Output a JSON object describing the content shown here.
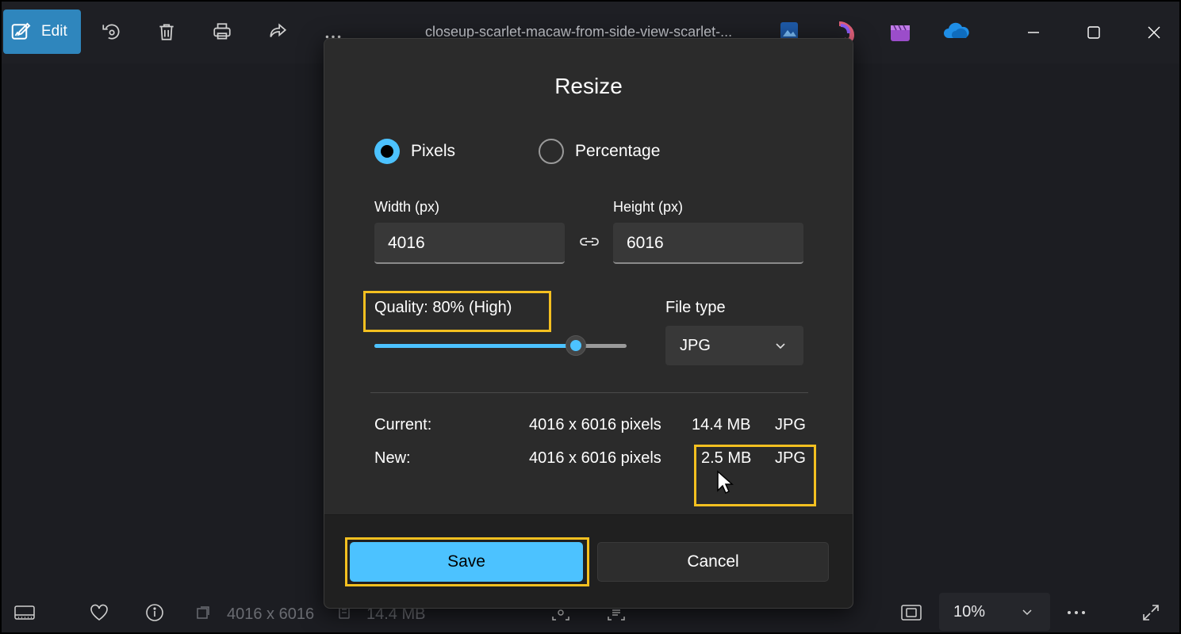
{
  "toolbar": {
    "edit_label": "Edit",
    "icons": [
      "edit-icon",
      "rotate-icon",
      "delete-icon",
      "print-icon",
      "share-icon",
      "more-icon"
    ],
    "file_title": "closeup-scarlet-macaw-from-side-view-scarlet-...",
    "app_icons": [
      "photo-editor-app-icon",
      "clipchamp-app-icon",
      "video-editor-app-icon",
      "onedrive-icon"
    ],
    "window_controls": [
      "minimize-icon",
      "maximize-icon",
      "close-icon"
    ]
  },
  "dialog": {
    "title": "Resize",
    "mode_options": [
      {
        "label": "Pixels",
        "checked": true
      },
      {
        "label": "Percentage",
        "checked": false
      }
    ],
    "width_label": "Width  (px)",
    "width_value": "4016",
    "height_label": "Height  (px)",
    "height_value": "6016",
    "quality_label": "Quality: 80% (High)",
    "quality_value": 0.8,
    "filetype_label": "File type",
    "filetype_value": "JPG",
    "current": {
      "label": "Current:",
      "dimensions": "4016 x 6016 pixels",
      "size": "14.4 MB",
      "type": "JPG"
    },
    "new": {
      "label": "New:",
      "dimensions": "4016 x 6016 pixels",
      "size": "2.5 MB",
      "type": "JPG"
    },
    "save_label": "Save",
    "cancel_label": "Cancel"
  },
  "bottombar": {
    "dimensions": "4016 x 6016",
    "file_size": "14.4 MB",
    "zoom": "10%"
  },
  "colors": {
    "accent": "#4cc2ff",
    "highlight": "#f4c020",
    "edit_button": "#2f86bd"
  }
}
